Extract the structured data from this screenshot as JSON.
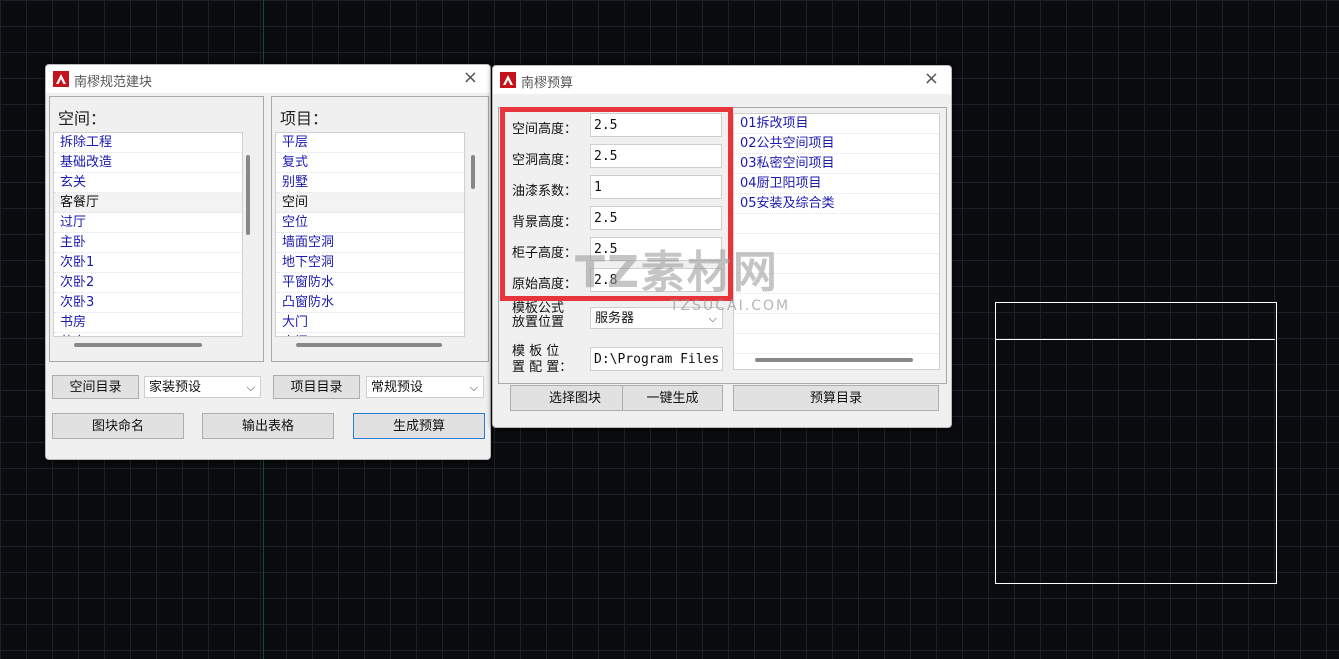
{
  "dialog1": {
    "title": "南樛规范建块",
    "close": "×",
    "space_title": "空间：",
    "project_title": "项目：",
    "space_items": [
      "拆除工程",
      "基础改造",
      "玄关",
      "客餐厅",
      "过厅",
      "主卧",
      "次卧1",
      "次卧2",
      "次卧3",
      "书房",
      "茶室"
    ],
    "space_selected": 3,
    "project_items": [
      "平层",
      "复式",
      "别墅",
      "空间",
      "空位",
      "墙面空洞",
      "地下空洞",
      "平窗防水",
      "凸窗防水",
      "大门",
      "房门"
    ],
    "project_selected": 3,
    "btn_space_catalog": "空间目录",
    "combo_space_preset": "家装预设",
    "btn_project_catalog": "项目目录",
    "combo_project_preset": "常规预设",
    "btn_block_name": "图块命名",
    "btn_export_table": "输出表格",
    "btn_generate_budget": "生成预算"
  },
  "dialog2": {
    "title": "南樛预算",
    "close": "×",
    "fields": [
      {
        "label": "空间高度：",
        "value": "2.5"
      },
      {
        "label": "空洞高度：",
        "value": "2.5"
      },
      {
        "label": "油漆系数：",
        "value": "1"
      },
      {
        "label": "背景高度：",
        "value": "2.5"
      },
      {
        "label": "柜子高度：",
        "value": "2.5"
      },
      {
        "label": "原始高度：",
        "value": "2.8"
      }
    ],
    "template_formula_label_1": "模板公式",
    "template_formula_label_2": "放置位置",
    "template_formula_value": "服务器",
    "template_path_label_1": "模 板 位",
    "template_path_label_2": "置 配 置：",
    "template_path_value": "D:\\Program Files",
    "list_items": [
      "01拆改项目",
      "02公共空间项目",
      "03私密空间项目",
      "04厨卫阳项目",
      "05安装及综合类"
    ],
    "btn_select_block": "选择图块",
    "btn_one_click": "一键生成",
    "btn_budget_catalog": "预算目录"
  },
  "watermark": {
    "main": "TZ素材网",
    "sub": "TZSUCAI.COM"
  },
  "colors": {
    "highlight": "#e8343a",
    "list_text": "#1a1ab0",
    "canvas_bg": "#0a0b0e"
  }
}
